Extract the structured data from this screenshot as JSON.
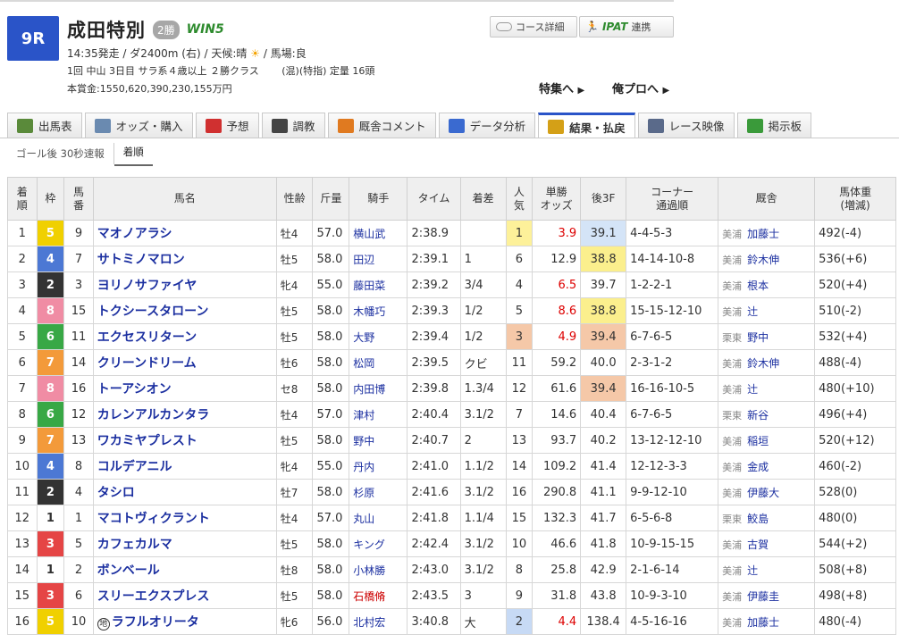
{
  "race": {
    "number": "9R",
    "name": "成田特別",
    "grade": "2勝",
    "win5": "WIN5",
    "data1_prefix": "14:35発走 / ダ2400m (右) / 天候:晴",
    "weather_icon": "☀",
    "data1_suffix": "/ 馬場:良",
    "data2": "1回 中山 3日目 サラ系４歳以上 ２勝クラス　　 (混)(特指) 定量 16頭",
    "data3": "本賞金:1550,620,390,230,155万円"
  },
  "header_buttons": {
    "course": "コース詳細",
    "ipat_logo": "IPAT",
    "ipat": "連携"
  },
  "header_links": {
    "tokushu": "特集へ",
    "orepro": "俺プロへ"
  },
  "tabs": [
    {
      "label": "出馬表",
      "icon": "table-icon",
      "color": "#5a8a3a"
    },
    {
      "label": "オッズ・購入",
      "icon": "odds-icon",
      "color": "#6a8ab0"
    },
    {
      "label": "予想",
      "icon": "target-icon",
      "color": "#d03030"
    },
    {
      "label": "調教",
      "icon": "stopwatch-icon",
      "color": "#444444"
    },
    {
      "label": "厩舎コメント",
      "icon": "stable-icon",
      "color": "#e07a20"
    },
    {
      "label": "データ分析",
      "icon": "bar-chart-icon",
      "color": "#3a6ad0"
    },
    {
      "label": "結果・払戻",
      "icon": "coins-icon",
      "color": "#d4a017"
    },
    {
      "label": "レース映像",
      "icon": "video-icon",
      "color": "#5a6a8a"
    },
    {
      "label": "掲示板",
      "icon": "chat-icon",
      "color": "#3a9a3a"
    }
  ],
  "active_tab": 6,
  "subtabs": [
    "ゴール後 30秒速報",
    "着順"
  ],
  "table": {
    "headers": [
      "着\n順",
      "枠",
      "馬\n番",
      "馬名",
      "性齢",
      "斤量",
      "騎手",
      "タイム",
      "着差",
      "人\n気",
      "単勝\nオッズ",
      "後3F",
      "コーナー\n通過順",
      "厩舎",
      "馬体重\n(増減)"
    ],
    "rows": [
      {
        "rank": "1",
        "waku": "5",
        "num": "9",
        "horse": "マオノアラシ",
        "chi": "",
        "sexage": "牡4",
        "kin": "57.0",
        "jockey": "横山武",
        "jred": false,
        "time": "2:38.9",
        "margin": "",
        "pop": "1",
        "odds": "3.9",
        "ored": true,
        "last3f": "39.1",
        "lrank": 1,
        "corner": "4-4-5-3",
        "aff": "美浦",
        "trainer": "加藤士",
        "weight": "492(-4)"
      },
      {
        "rank": "2",
        "waku": "4",
        "num": "7",
        "horse": "サトミノマロン",
        "chi": "",
        "sexage": "牡5",
        "kin": "58.0",
        "jockey": "田辺",
        "jred": false,
        "time": "2:39.1",
        "margin": "1",
        "pop": "6",
        "odds": "12.9",
        "ored": false,
        "last3f": "38.8",
        "lrank": 2,
        "corner": "14-14-10-8",
        "aff": "美浦",
        "trainer": "鈴木伸",
        "weight": "536(+6)"
      },
      {
        "rank": "3",
        "waku": "2",
        "num": "3",
        "horse": "ヨリノサファイヤ",
        "chi": "",
        "sexage": "牝4",
        "kin": "55.0",
        "jockey": "藤田菜",
        "jred": false,
        "time": "2:39.2",
        "margin": "3/4",
        "pop": "4",
        "odds": "6.5",
        "ored": true,
        "last3f": "39.7",
        "lrank": 0,
        "corner": "1-2-2-1",
        "aff": "美浦",
        "trainer": "根本",
        "weight": "520(+4)"
      },
      {
        "rank": "4",
        "waku": "8",
        "num": "15",
        "horse": "トクシースタローン",
        "chi": "",
        "sexage": "牡5",
        "kin": "58.0",
        "jockey": "木幡巧",
        "jred": false,
        "time": "2:39.3",
        "margin": "1/2",
        "pop": "5",
        "odds": "8.6",
        "ored": true,
        "last3f": "38.8",
        "lrank": 2,
        "corner": "15-15-12-10",
        "aff": "美浦",
        "trainer": "辻",
        "weight": "510(-2)"
      },
      {
        "rank": "5",
        "waku": "6",
        "num": "11",
        "horse": "エクセスリターン",
        "chi": "",
        "sexage": "牡5",
        "kin": "58.0",
        "jockey": "大野",
        "jred": false,
        "time": "2:39.4",
        "margin": "1/2",
        "pop": "3",
        "odds": "4.9",
        "ored": true,
        "last3f": "39.4",
        "lrank": 3,
        "corner": "6-7-6-5",
        "aff": "栗東",
        "trainer": "野中",
        "weight": "532(+4)"
      },
      {
        "rank": "6",
        "waku": "7",
        "num": "14",
        "horse": "クリーンドリーム",
        "chi": "",
        "sexage": "牡6",
        "kin": "58.0",
        "jockey": "松岡",
        "jred": false,
        "time": "2:39.5",
        "margin": "クビ",
        "pop": "11",
        "odds": "59.2",
        "ored": false,
        "last3f": "40.0",
        "lrank": 0,
        "corner": "2-3-1-2",
        "aff": "美浦",
        "trainer": "鈴木伸",
        "weight": "488(-4)"
      },
      {
        "rank": "7",
        "waku": "8",
        "num": "16",
        "horse": "トーアシオン",
        "chi": "",
        "sexage": "セ8",
        "kin": "58.0",
        "jockey": "内田博",
        "jred": false,
        "time": "2:39.8",
        "margin": "1.3/4",
        "pop": "12",
        "odds": "61.6",
        "ored": false,
        "last3f": "39.4",
        "lrank": 3,
        "corner": "16-16-10-5",
        "aff": "美浦",
        "trainer": "辻",
        "weight": "480(+10)"
      },
      {
        "rank": "8",
        "waku": "6",
        "num": "12",
        "horse": "カレンアルカンタラ",
        "chi": "",
        "sexage": "牡4",
        "kin": "57.0",
        "jockey": "津村",
        "jred": false,
        "time": "2:40.4",
        "margin": "3.1/2",
        "pop": "7",
        "odds": "14.6",
        "ored": false,
        "last3f": "40.4",
        "lrank": 0,
        "corner": "6-7-6-5",
        "aff": "栗東",
        "trainer": "新谷",
        "weight": "496(+4)"
      },
      {
        "rank": "9",
        "waku": "7",
        "num": "13",
        "horse": "ワカミヤプレスト",
        "chi": "",
        "sexage": "牡5",
        "kin": "58.0",
        "jockey": "野中",
        "jred": false,
        "time": "2:40.7",
        "margin": "2",
        "pop": "13",
        "odds": "93.7",
        "ored": false,
        "last3f": "40.2",
        "lrank": 0,
        "corner": "13-12-12-10",
        "aff": "美浦",
        "trainer": "稲垣",
        "weight": "520(+12)"
      },
      {
        "rank": "10",
        "waku": "4",
        "num": "8",
        "horse": "コルデアニル",
        "chi": "",
        "sexage": "牝4",
        "kin": "55.0",
        "jockey": "丹内",
        "jred": false,
        "time": "2:41.0",
        "margin": "1.1/2",
        "pop": "14",
        "odds": "109.2",
        "ored": false,
        "last3f": "41.4",
        "lrank": 0,
        "corner": "12-12-3-3",
        "aff": "美浦",
        "trainer": "金成",
        "weight": "460(-2)"
      },
      {
        "rank": "11",
        "waku": "2",
        "num": "4",
        "horse": "タシロ",
        "chi": "",
        "sexage": "牡7",
        "kin": "58.0",
        "jockey": "杉原",
        "jred": false,
        "time": "2:41.6",
        "margin": "3.1/2",
        "pop": "16",
        "odds": "290.8",
        "ored": false,
        "last3f": "41.1",
        "lrank": 0,
        "corner": "9-9-12-10",
        "aff": "美浦",
        "trainer": "伊藤大",
        "weight": "528(0)"
      },
      {
        "rank": "12",
        "waku": "1",
        "num": "1",
        "horse": "マコトヴィクラント",
        "chi": "",
        "sexage": "牡4",
        "kin": "57.0",
        "jockey": "丸山",
        "jred": false,
        "time": "2:41.8",
        "margin": "1.1/4",
        "pop": "15",
        "odds": "132.3",
        "ored": false,
        "last3f": "41.7",
        "lrank": 0,
        "corner": "6-5-6-8",
        "aff": "栗東",
        "trainer": "鮫島",
        "weight": "480(0)"
      },
      {
        "rank": "13",
        "waku": "3",
        "num": "5",
        "horse": "カフェカルマ",
        "chi": "",
        "sexage": "牡5",
        "kin": "58.0",
        "jockey": "キング",
        "jred": false,
        "time": "2:42.4",
        "margin": "3.1/2",
        "pop": "10",
        "odds": "46.6",
        "ored": false,
        "last3f": "41.8",
        "lrank": 0,
        "corner": "10-9-15-15",
        "aff": "美浦",
        "trainer": "古賀",
        "weight": "544(+2)"
      },
      {
        "rank": "14",
        "waku": "1",
        "num": "2",
        "horse": "ボンベール",
        "chi": "",
        "sexage": "牡8",
        "kin": "58.0",
        "jockey": "小林勝",
        "jred": false,
        "time": "2:43.0",
        "margin": "3.1/2",
        "pop": "8",
        "odds": "25.8",
        "ored": false,
        "last3f": "42.9",
        "lrank": 0,
        "corner": "2-1-6-14",
        "aff": "美浦",
        "trainer": "辻",
        "weight": "508(+8)"
      },
      {
        "rank": "15",
        "waku": "3",
        "num": "6",
        "horse": "スリーエクスプレス",
        "chi": "",
        "sexage": "牡5",
        "kin": "58.0",
        "jockey": "石橋脩",
        "jred": true,
        "time": "2:43.5",
        "margin": "3",
        "pop": "9",
        "odds": "31.8",
        "ored": false,
        "last3f": "43.8",
        "lrank": 0,
        "corner": "10-9-3-10",
        "aff": "美浦",
        "trainer": "伊藤圭",
        "weight": "498(+8)"
      },
      {
        "rank": "16",
        "waku": "5",
        "num": "10",
        "horse": "ラフルオリータ",
        "chi": "地",
        "sexage": "牝6",
        "kin": "56.0",
        "jockey": "北村宏",
        "jred": false,
        "time": "3:40.8",
        "margin": "大",
        "pop": "2",
        "odds": "4.4",
        "ored": true,
        "last3f": "138.4",
        "lrank": 0,
        "corner": "4-5-16-16",
        "aff": "美浦",
        "trainer": "加藤士",
        "weight": "480(-4)"
      }
    ]
  }
}
